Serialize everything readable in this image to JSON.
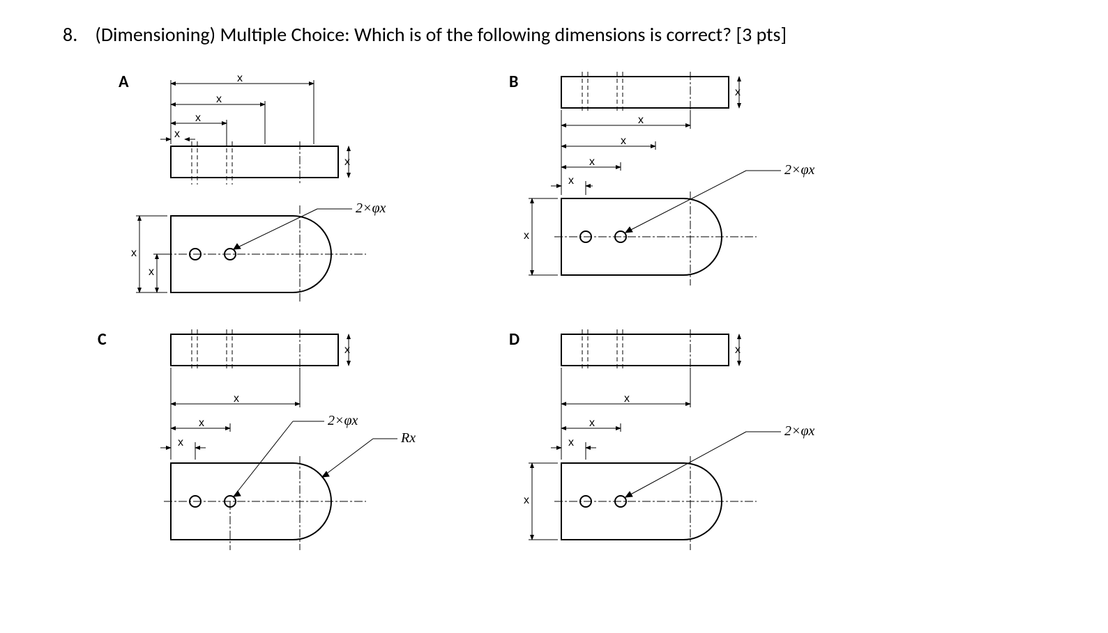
{
  "question": {
    "number": "8.",
    "text": "(Dimensioning) Multiple Choice: Which is of the following dimensions is correct? [3 pts]"
  },
  "options": {
    "A": {
      "label": "A",
      "dims": [
        "x",
        "x",
        "x",
        "x",
        "x",
        "x",
        "x"
      ],
      "note": "2×φx"
    },
    "B": {
      "label": "B",
      "dims": [
        "x",
        "x",
        "x",
        "x",
        "x",
        "x"
      ],
      "note": "2×φx"
    },
    "C": {
      "label": "C",
      "dims": [
        "x",
        "x",
        "x",
        "x"
      ],
      "note": "2×φx",
      "radius": "Rx"
    },
    "D": {
      "label": "D",
      "dims": [
        "x",
        "x",
        "x",
        "x",
        "x"
      ],
      "note": "2×φx"
    }
  },
  "dim_symbol": "x",
  "hole_note": "2×φx",
  "radius_note": "Rx"
}
